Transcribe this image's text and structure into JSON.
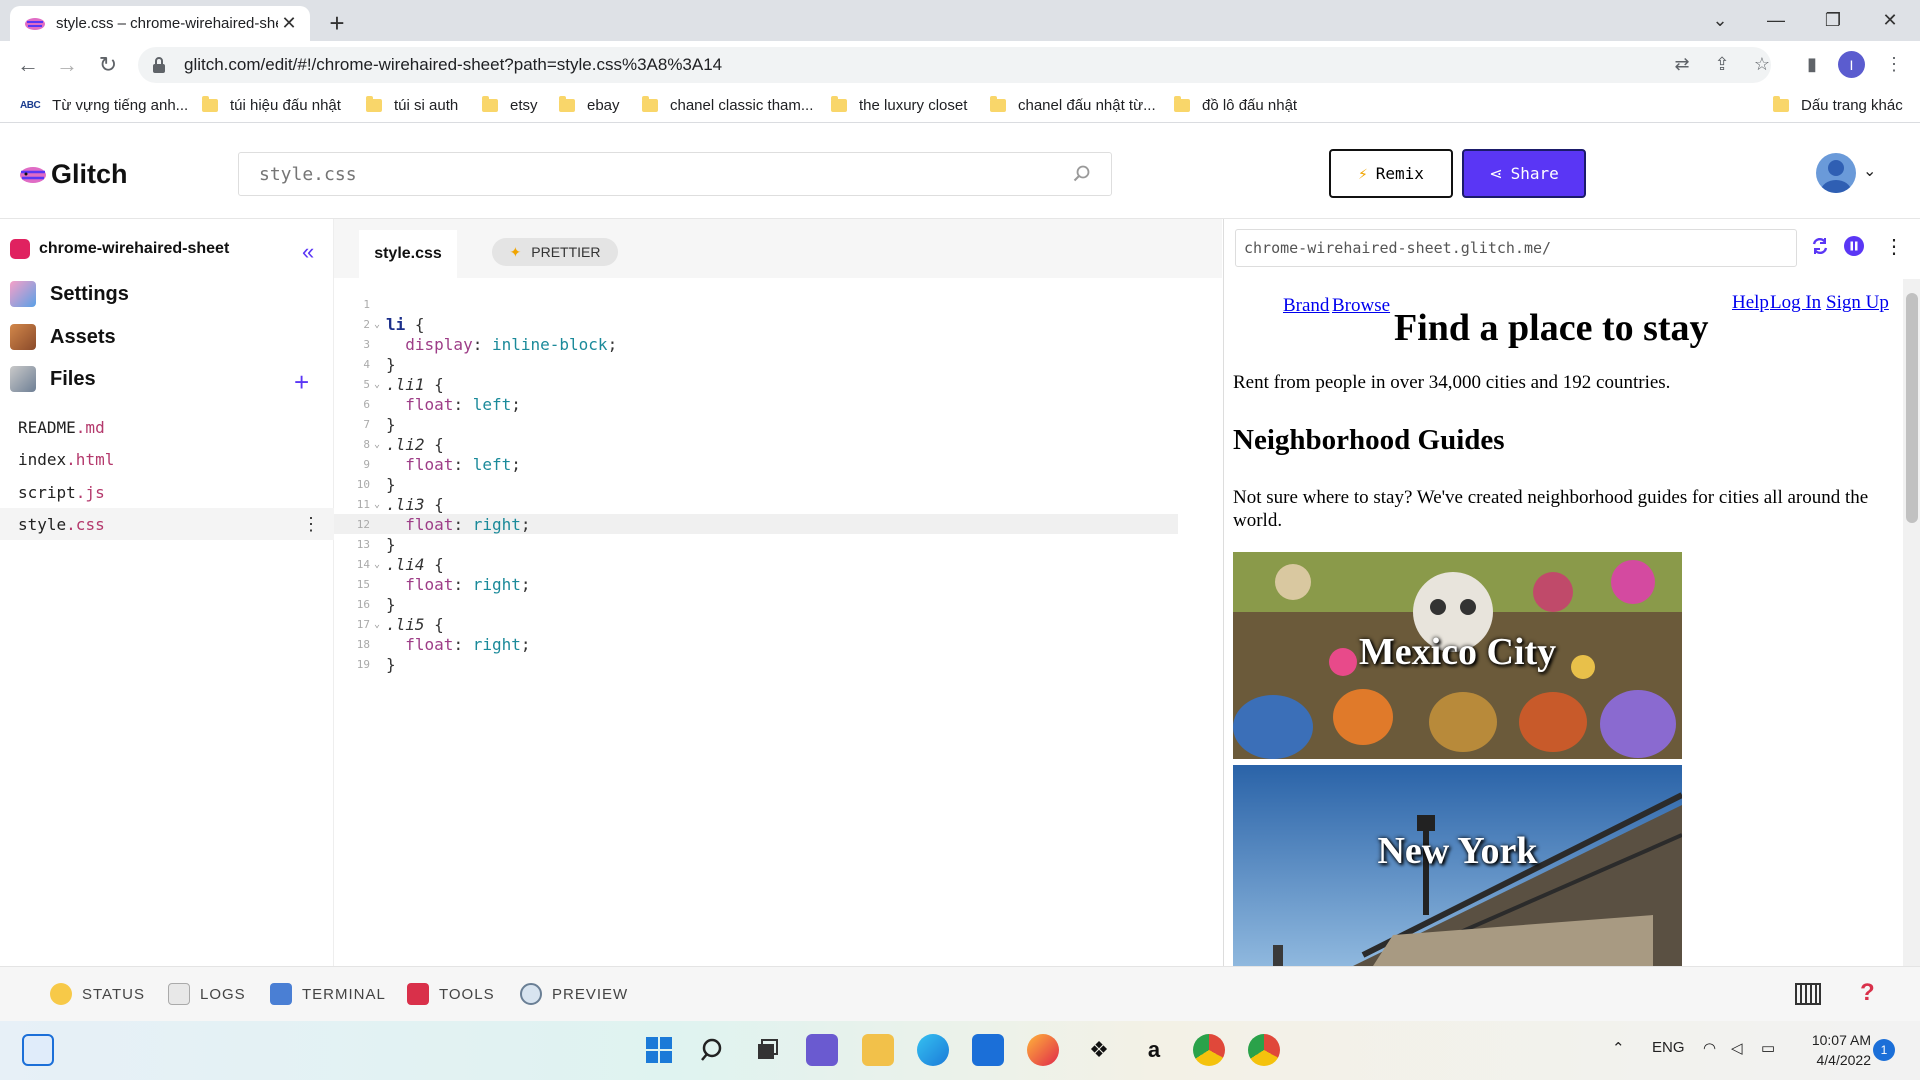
{
  "browser": {
    "tab_title": "style.css – chrome-wirehaired-she",
    "url": "glitch.com/edit/#!/chrome-wirehaired-sheet?path=style.css%3A8%3A14",
    "profile_initial": "I",
    "bookmarks": [
      {
        "label": "Từ vựng tiếng anh...",
        "icon": "abc-icon"
      },
      {
        "label": "túi hiệu đấu nhật",
        "icon": "folder-icon"
      },
      {
        "label": "túi si auth",
        "icon": "folder-icon"
      },
      {
        "label": "etsy",
        "icon": "folder-icon"
      },
      {
        "label": "ebay",
        "icon": "folder-icon"
      },
      {
        "label": "chanel classic tham...",
        "icon": "folder-icon"
      },
      {
        "label": "the luxury closet",
        "icon": "folder-icon"
      },
      {
        "label": "chanel đấu nhật từ...",
        "icon": "folder-icon"
      },
      {
        "label": "đồ lô đấu nhật",
        "icon": "folder-icon"
      }
    ],
    "other_bookmarks": "Dấu trang khác"
  },
  "glitch": {
    "logo_text": "Glitch",
    "search_placeholder": "style.css",
    "remix_label": "Remix",
    "share_label": "Share",
    "accent_color": "#5a36f5"
  },
  "sidebar": {
    "project_name": "chrome-wirehaired-sheet",
    "nav": [
      {
        "label": "Settings",
        "icon": "settings-icon"
      },
      {
        "label": "Assets",
        "icon": "assets-icon"
      },
      {
        "label": "Files",
        "icon": "files-icon"
      }
    ],
    "files": [
      {
        "name": "README",
        "ext": ".md"
      },
      {
        "name": "index",
        "ext": ".html"
      },
      {
        "name": "script",
        "ext": ".js"
      },
      {
        "name": "style",
        "ext": ".css",
        "active": true
      }
    ]
  },
  "editor": {
    "tab_label": "style.css",
    "prettier_label": "PRETTIER",
    "lines": [
      "",
      "li {",
      "  display: inline-block;",
      "}",
      ".li1 {",
      "  float: left;",
      "}",
      ".li2 {",
      "  float: left;",
      "}",
      ".li3 {",
      "  float: right;",
      "}",
      ".li4 {",
      "  float: right;",
      "}",
      ".li5 {",
      "  float: right;",
      "}"
    ],
    "highlighted_line": 12
  },
  "preview": {
    "url": "chrome-wirehaired-sheet.glitch.me/",
    "nav_left": [
      "Brand",
      "Browse"
    ],
    "nav_right": [
      "Help",
      "Log In",
      "Sign Up"
    ],
    "heading": "Find a place to stay",
    "intro": "Rent from people in over 34,000 cities and 192 countries.",
    "guides_heading": "Neighborhood Guides",
    "guides_text": "Not sure where to stay? We've created neighborhood guides for cities all around the world.",
    "cards": [
      "Mexico City",
      "New York"
    ]
  },
  "bottom_bar": [
    {
      "label": "STATUS",
      "icon": "smiley-icon"
    },
    {
      "label": "LOGS",
      "icon": "logs-icon"
    },
    {
      "label": "TERMINAL",
      "icon": "terminal-icon"
    },
    {
      "label": "TOOLS",
      "icon": "toolbox-icon"
    },
    {
      "label": "PREVIEW",
      "icon": "magnifier-icon"
    }
  ],
  "taskbar": {
    "lang": "ENG",
    "time": "10:07 AM",
    "date": "4/4/2022",
    "notifications": "1"
  }
}
